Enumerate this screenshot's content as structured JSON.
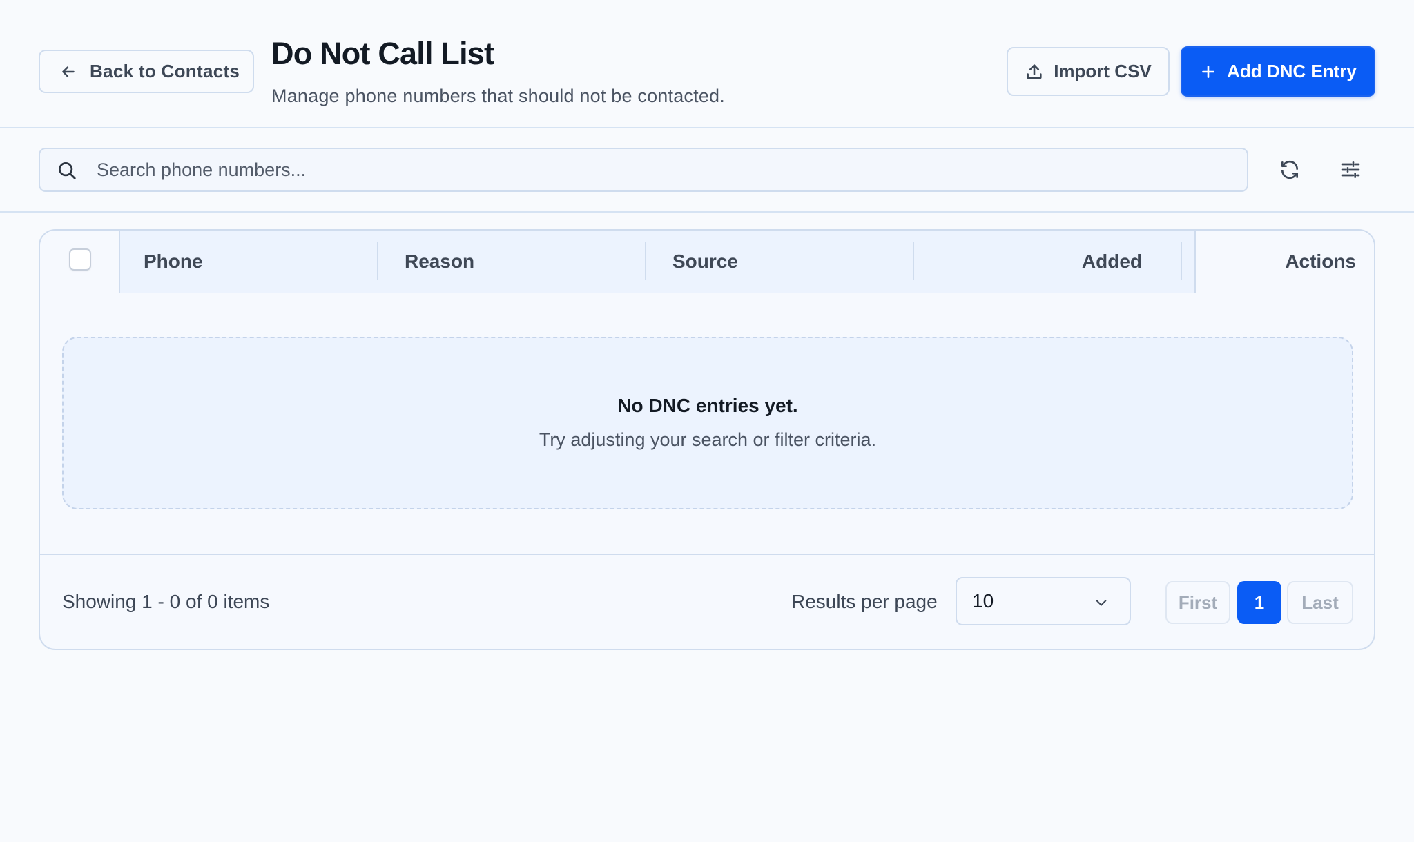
{
  "header": {
    "back_label": "Back to Contacts",
    "title": "Do Not Call List",
    "subtitle": "Manage phone numbers that should not be contacted.",
    "import_label": "Import CSV",
    "add_label": "Add DNC Entry"
  },
  "search": {
    "placeholder": "Search phone numbers..."
  },
  "table": {
    "columns": [
      "Phone",
      "Reason",
      "Source",
      "Added",
      "Actions"
    ],
    "empty_title": "No DNC entries yet.",
    "empty_subtitle": "Try adjusting your search or filter criteria."
  },
  "footer": {
    "showing": "Showing 1 - 0 of 0 items",
    "results_per_page_label": "Results per page",
    "results_per_page_value": "10",
    "first_label": "First",
    "current_page": "1",
    "last_label": "Last"
  },
  "colors": {
    "primary": "#0a5cf5",
    "background": "#f8fafd",
    "border": "#cfdcee",
    "header_cell": "#ecf3fe"
  },
  "icons": {
    "back": "arrow-left-icon",
    "import": "upload-icon",
    "add": "plus-icon",
    "search": "search-icon",
    "refresh": "refresh-icon",
    "filter": "sliders-icon",
    "dropdown": "chevron-down-icon"
  }
}
